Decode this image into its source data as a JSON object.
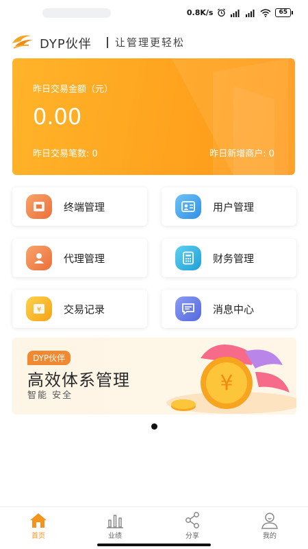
{
  "status_bar": {
    "speed": "0.8K/s",
    "battery": "65"
  },
  "header": {
    "brand": "DYP伙伴",
    "slogan": "让管理更轻松"
  },
  "summary_card": {
    "amount_label": "昨日交易金额（元）",
    "amount_value": "0.00",
    "tx_count_label": "昨日交易笔数: 0",
    "new_merchant_label": "昨日新增商户: 0",
    "color": "#ffa21e"
  },
  "menu": [
    {
      "label": "终端管理",
      "icon": "terminal-icon",
      "color": "#f2844f"
    },
    {
      "label": "用户管理",
      "icon": "user-card-icon",
      "color": "#4aa8ee"
    },
    {
      "label": "代理管理",
      "icon": "agent-icon",
      "color": "#f2844f"
    },
    {
      "label": "财务管理",
      "icon": "finance-icon",
      "color": "#36b3e6"
    },
    {
      "label": "交易记录",
      "icon": "transaction-icon",
      "color": "#f8b927"
    },
    {
      "label": "消息中心",
      "icon": "message-icon",
      "color": "#6f82e6"
    }
  ],
  "banner": {
    "tag": "DYP伙伴",
    "headline": "高效体系管理",
    "sub": "智能 安全"
  },
  "tabbar": [
    {
      "label": "首页",
      "icon": "home-icon",
      "active": true
    },
    {
      "label": "业绩",
      "icon": "bar-chart-icon",
      "active": false
    },
    {
      "label": "分享",
      "icon": "share-icon",
      "active": false
    },
    {
      "label": "我的",
      "icon": "profile-icon",
      "active": false
    }
  ],
  "accent_color": "#f5931f"
}
